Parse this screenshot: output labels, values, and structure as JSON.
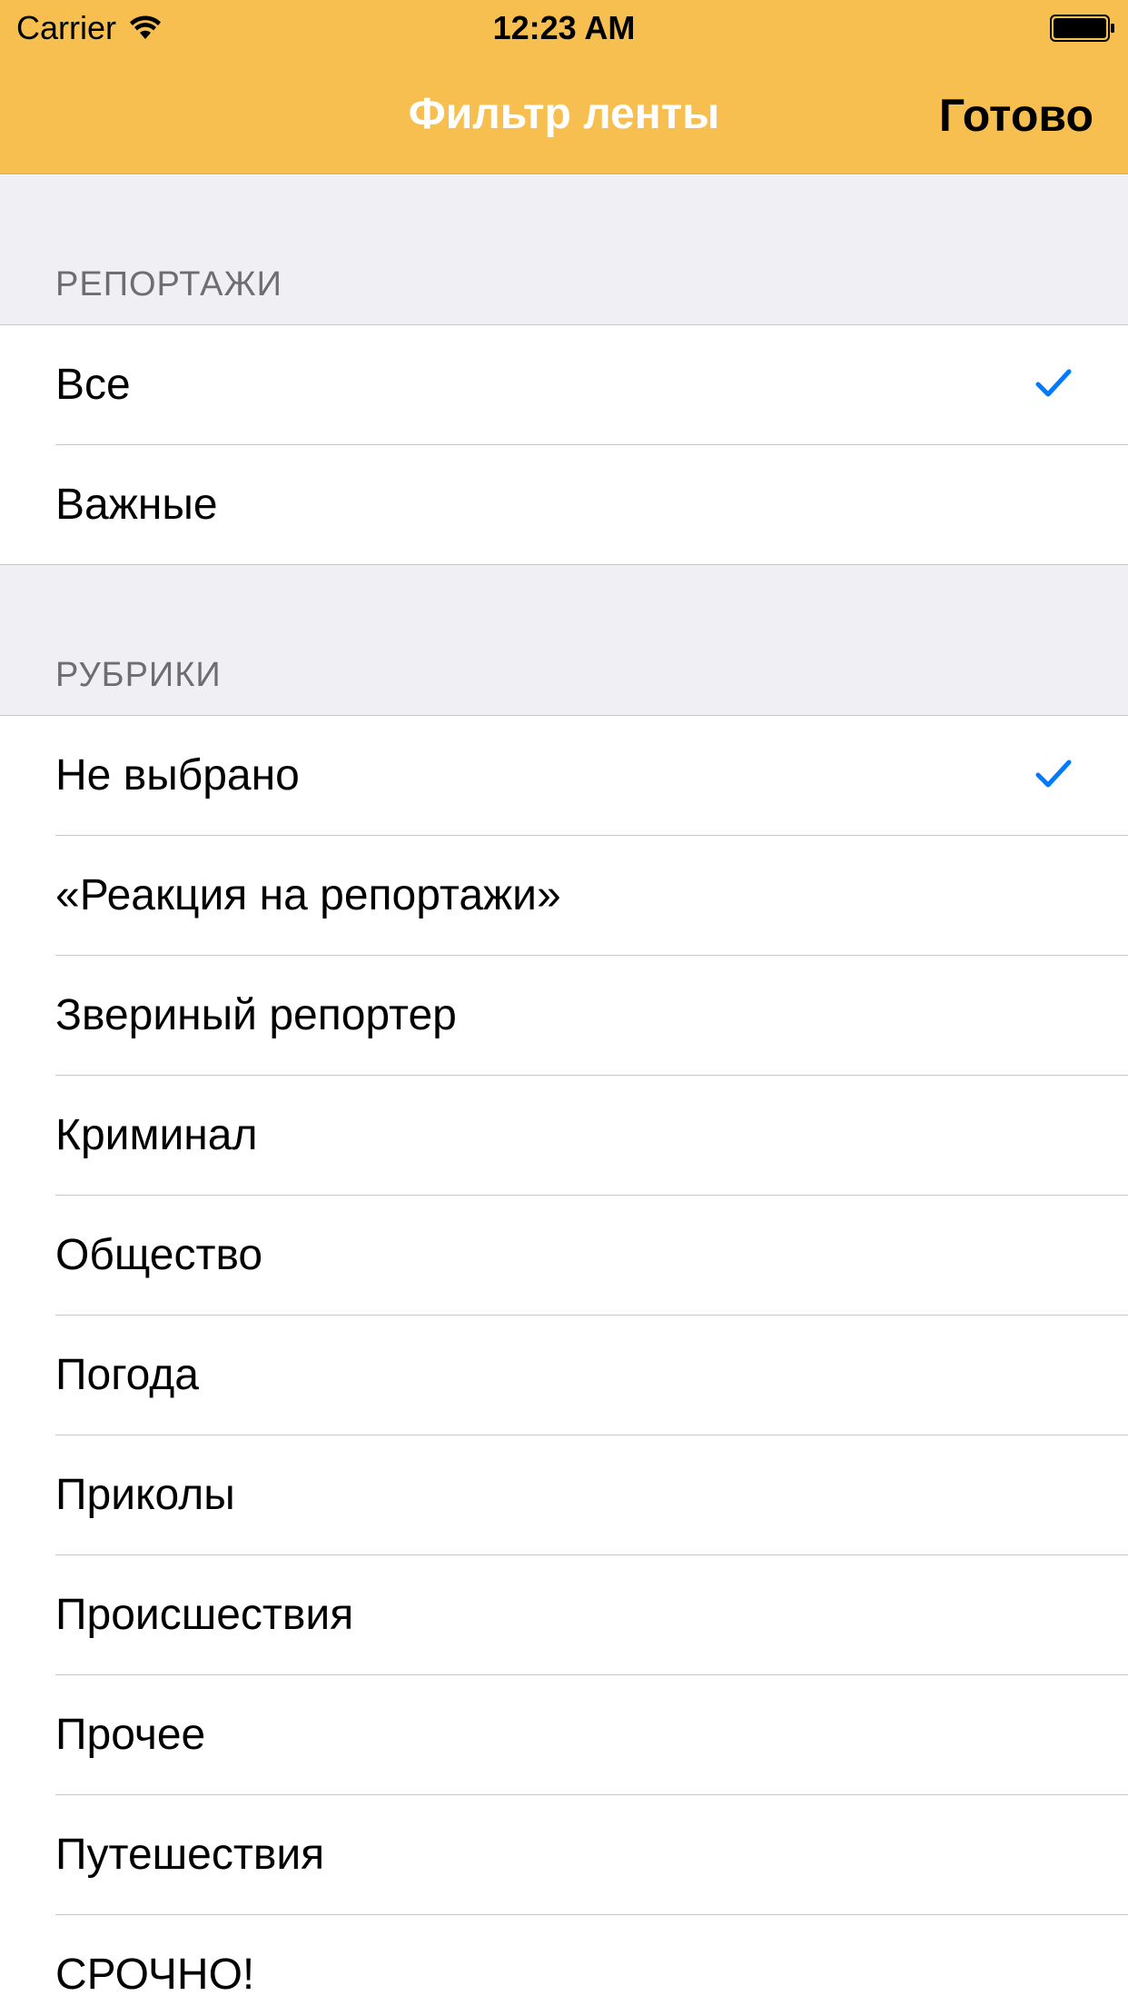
{
  "status_bar": {
    "carrier": "Carrier",
    "time": "12:23 AM"
  },
  "nav": {
    "title": "Фильтр ленты",
    "done_label": "Готово"
  },
  "sections": [
    {
      "header": "РЕПОРТАЖИ",
      "items": [
        {
          "label": "Все",
          "checked": true
        },
        {
          "label": "Важные",
          "checked": false
        }
      ]
    },
    {
      "header": "РУБРИКИ",
      "items": [
        {
          "label": "Не выбрано",
          "checked": true
        },
        {
          "label": "«Реакция на репортажи»",
          "checked": false
        },
        {
          "label": "Звериный репортер",
          "checked": false
        },
        {
          "label": "Криминал",
          "checked": false
        },
        {
          "label": "Общество",
          "checked": false
        },
        {
          "label": "Погода",
          "checked": false
        },
        {
          "label": "Приколы",
          "checked": false
        },
        {
          "label": "Происшествия",
          "checked": false
        },
        {
          "label": "Прочее",
          "checked": false
        },
        {
          "label": "Путешествия",
          "checked": false
        },
        {
          "label": "СРОЧНО!",
          "checked": false
        }
      ]
    }
  ],
  "colors": {
    "header_bg": "#f6bf4f",
    "checkmark": "#007aff",
    "section_bg": "#efeff4"
  },
  "icons": {
    "wifi": "wifi-icon",
    "battery": "battery-icon",
    "check": "checkmark-icon"
  }
}
